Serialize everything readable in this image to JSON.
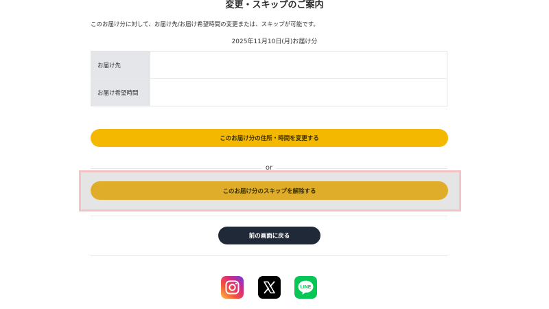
{
  "heading": "変更・スキップのご案内",
  "description": "このお届け分に対して、お届け先/お届け希望時間の変更または、スキップが可能です。",
  "delivery_date": "2025年11月10日(月)お届け分",
  "info_table": {
    "rows": [
      {
        "label": "お届け先",
        "value": ""
      },
      {
        "label": "お届け希望時間",
        "value": ""
      }
    ]
  },
  "buttons": {
    "change_label": "このお届け分の住所・時間を変更する",
    "or_label": "or",
    "unskip_label": "このお届け分のスキップを解除する",
    "back_label": "前の画面に戻る"
  },
  "social": [
    {
      "name": "instagram-icon"
    },
    {
      "name": "x-icon"
    },
    {
      "name": "line-icon",
      "text": "LINE"
    }
  ],
  "colors": {
    "primary_button": "#f5b800",
    "unskip_button": "#dfad2a",
    "back_button": "#1f2937",
    "highlight_border": "#f4c3c6",
    "line_green": "#06c755"
  }
}
